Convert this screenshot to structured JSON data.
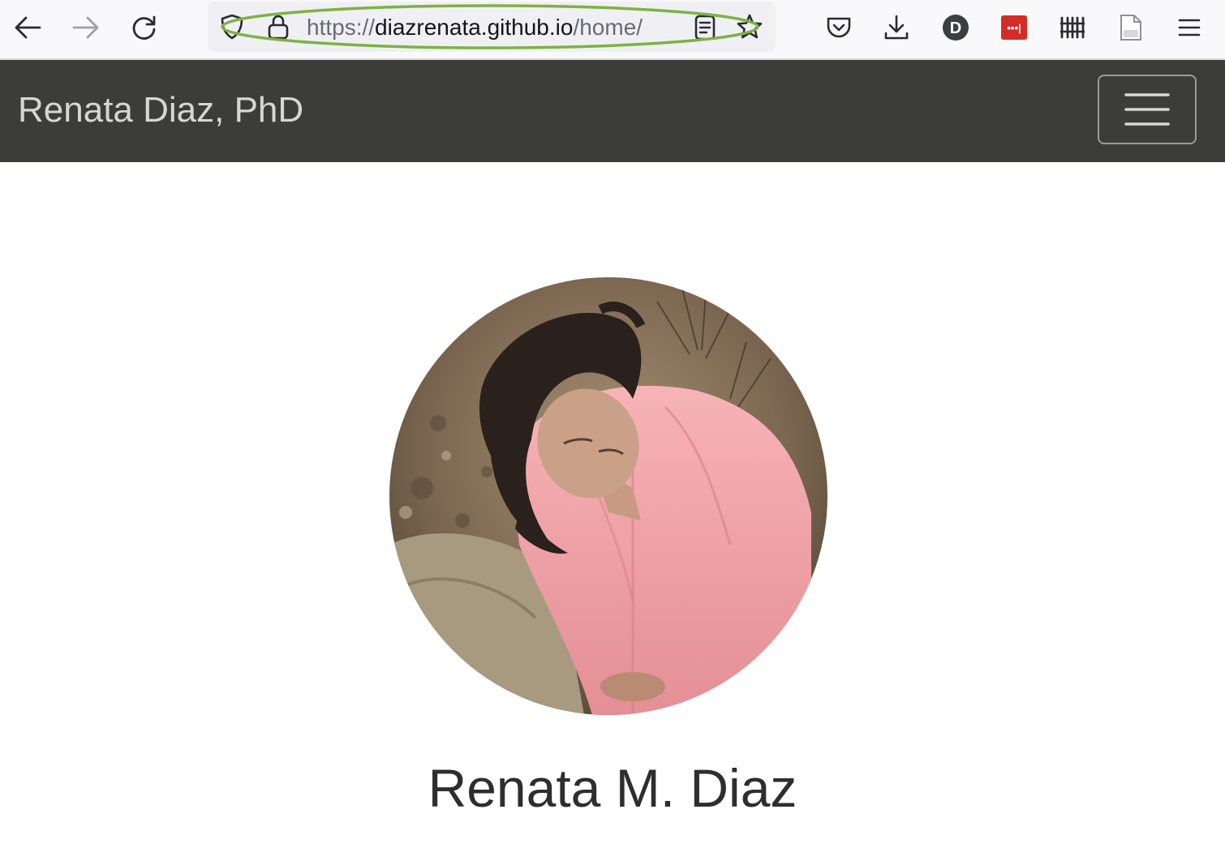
{
  "browser": {
    "url_scheme": "https://",
    "url_host": "diazrenata.github.io",
    "url_path": "/home/",
    "extension_avatar_letter": "D",
    "lastpass_dots": "•••|",
    "icons": [
      "back-icon",
      "forward-icon",
      "reload-icon",
      "tracking-shield-icon",
      "lock-icon",
      "reader-view-icon",
      "bookmark-star-icon",
      "pocket-icon",
      "download-icon",
      "extension-d-icon",
      "lastpass-icon",
      "library-icon",
      "page-icon",
      "app-menu-icon"
    ],
    "colors": {
      "toolbar_bg": "#f9f9fb",
      "urlbar_bg": "#f0f0f4",
      "highlight_ellipse": "#7cb342",
      "lastpass_red": "#d32d27"
    }
  },
  "site": {
    "brand": "Renata Diaz, PhD",
    "menu_toggle_icon": "hamburger-icon",
    "profile_photo_label": "profile-photo",
    "hero_name": "Renata M. Diaz",
    "colors": {
      "navbar_bg": "#3c3d38",
      "brand_text": "#d6d6d3",
      "shirt_pink": "#f3a4a8"
    }
  }
}
